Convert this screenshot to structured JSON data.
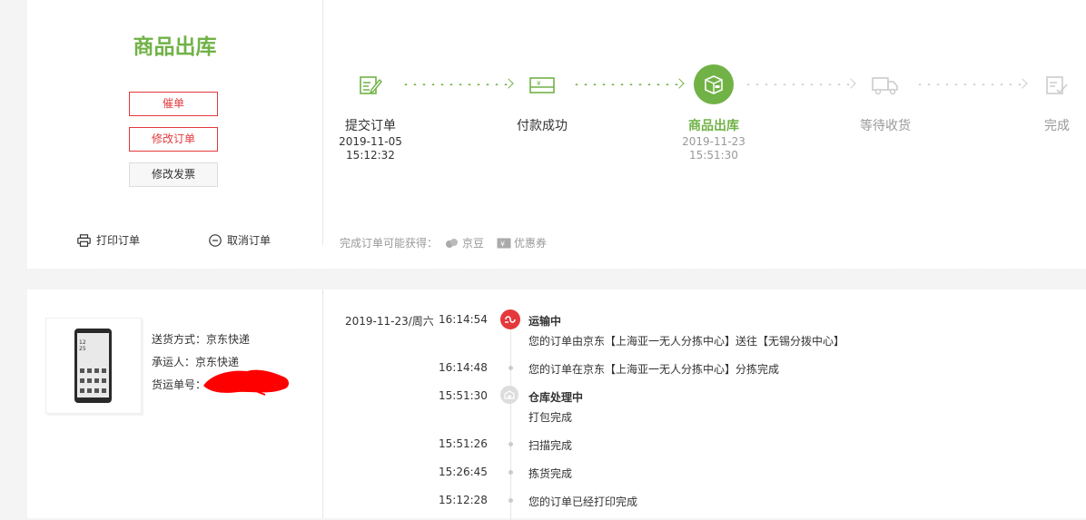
{
  "order_status": {
    "title": "商品出库",
    "buttons": {
      "urge": "催单",
      "modify_order": "修改订单",
      "modify_invoice": "修改发票"
    },
    "links": {
      "print": "打印订单",
      "cancel": "取消订单"
    }
  },
  "progress": {
    "steps": [
      {
        "name": "提交订单",
        "date": "2019-11-05",
        "time": "15:12:32",
        "state": "done",
        "icon": "edit-form-icon"
      },
      {
        "name": "付款成功",
        "date": "",
        "time": "",
        "state": "done",
        "icon": "payment-card-icon"
      },
      {
        "name": "商品出库",
        "date": "2019-11-23",
        "time": "15:51:30",
        "state": "current",
        "icon": "package-box-icon"
      },
      {
        "name": "等待收货",
        "date": "",
        "time": "",
        "state": "pending",
        "icon": "delivery-truck-icon"
      },
      {
        "name": "完成",
        "date": "",
        "time": "",
        "state": "pending",
        "icon": "checklist-icon"
      }
    ],
    "bonus": {
      "label": "完成订单可能获得：",
      "jingdou": "京豆",
      "coupon": "优惠券"
    }
  },
  "shipping": {
    "method": "送货方式：京东快递",
    "carrier": "承运人：京东快递",
    "tracking_label": "货运单号："
  },
  "timeline": [
    {
      "date": "2019-11-23/周六",
      "time": "16:14:54",
      "status": "运输中",
      "text": "您的订单由京东【上海亚一无人分拣中心】送往【无锡分拨中心】"
    },
    {
      "date": "",
      "time": "16:14:48",
      "status": "",
      "text": "您的订单在京东【上海亚一无人分拣中心】分拣完成"
    },
    {
      "date": "",
      "time": "15:51:30",
      "status": "仓库处理中",
      "text": "打包完成"
    },
    {
      "date": "",
      "time": "15:51:26",
      "status": "",
      "text": "扫描完成"
    },
    {
      "date": "",
      "time": "15:26:45",
      "status": "",
      "text": "拣货完成"
    },
    {
      "date": "",
      "time": "15:12:28",
      "status": "",
      "text": "您的订单已经打印完成"
    }
  ],
  "colors": {
    "accent_green": "#71b247",
    "accent_red": "#e4393c",
    "muted": "#999999"
  }
}
